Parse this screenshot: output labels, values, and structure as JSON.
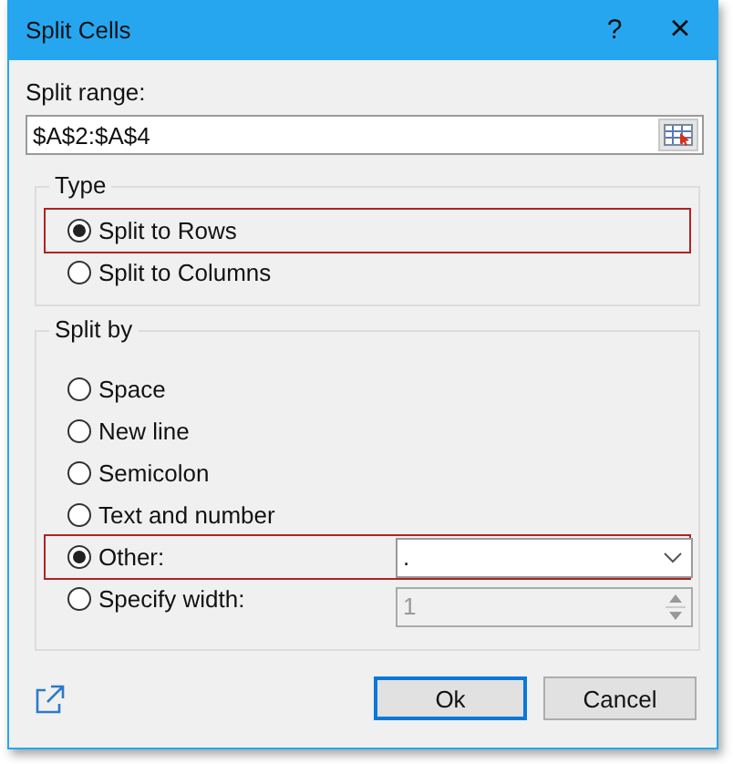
{
  "window": {
    "title": "Split Cells",
    "help": "?",
    "close": "×"
  },
  "range": {
    "label": "Split range:",
    "value": "$A$2:$A$4"
  },
  "type_group": {
    "title": "Type",
    "options": [
      {
        "label": "Split to Rows",
        "selected": true,
        "highlighted": true
      },
      {
        "label": "Split to Columns",
        "selected": false,
        "highlighted": false
      }
    ]
  },
  "split_by": {
    "title": "Split by",
    "options": [
      {
        "label": "Space",
        "selected": false,
        "kind": "plain"
      },
      {
        "label": "New line",
        "selected": false,
        "kind": "plain"
      },
      {
        "label": "Semicolon",
        "selected": false,
        "kind": "plain"
      },
      {
        "label": "Text and number",
        "selected": false,
        "kind": "plain"
      },
      {
        "label": "Other:",
        "selected": true,
        "kind": "dropdown",
        "value": ".",
        "highlighted": true
      },
      {
        "label": "Specify width:",
        "selected": false,
        "kind": "spinner",
        "value": "1",
        "disabled": true
      }
    ]
  },
  "buttons": [
    {
      "label": "Ok",
      "default": true
    },
    {
      "label": "Cancel",
      "default": false
    }
  ]
}
